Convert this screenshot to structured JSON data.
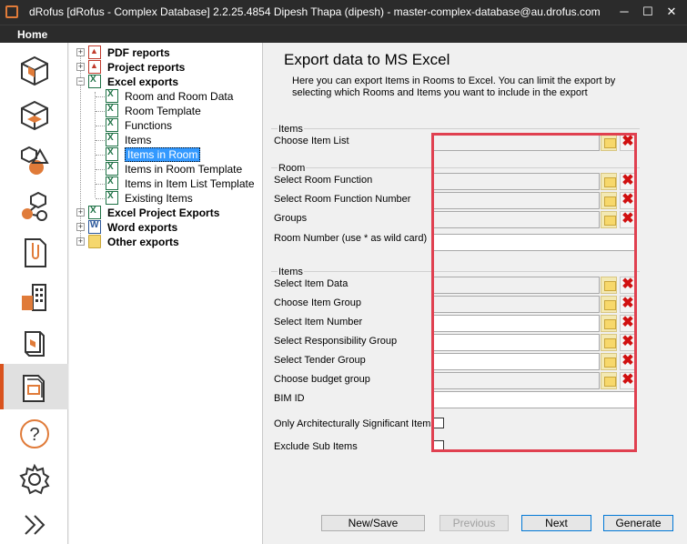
{
  "window": {
    "title": "dRofus [dRofus - Complex Database] 2.2.25.4854   Dipesh Thapa (dipesh) - master-complex-database@au.drofus.com",
    "minimize": "─",
    "maximize": "☐",
    "close": "✕"
  },
  "menubar": {
    "home": "Home"
  },
  "sidebar": {
    "icons": [
      "rooms-3d-icon",
      "room-template-icon",
      "shapes-icon",
      "items-network-icon",
      "document-clip-icon",
      "building-icon",
      "books-icon",
      "reports-icon",
      "help-icon",
      "settings-gear-icon",
      "expand-chevrons-icon"
    ],
    "active_index": 7,
    "help_glyph": "?",
    "expand_glyph": "»"
  },
  "tree": {
    "expand_glyph": "+",
    "collapse_glyph": "−",
    "nodes": [
      {
        "label": "PDF reports",
        "icon": "pdf",
        "level": 0,
        "bold": true,
        "expander": "+"
      },
      {
        "label": "Project reports",
        "icon": "pdf",
        "level": 0,
        "bold": true,
        "expander": "+"
      },
      {
        "label": "Excel exports",
        "icon": "xls",
        "level": 0,
        "bold": true,
        "expander": "−"
      },
      {
        "label": "Room and Room Data",
        "icon": "xls",
        "level": 1,
        "bold": false
      },
      {
        "label": "Room Template",
        "icon": "xls",
        "level": 1,
        "bold": false
      },
      {
        "label": "Functions",
        "icon": "xls",
        "level": 1,
        "bold": false
      },
      {
        "label": "Items",
        "icon": "xls",
        "level": 1,
        "bold": false
      },
      {
        "label": "Items in Room",
        "icon": "xls",
        "level": 1,
        "bold": false,
        "selected": true
      },
      {
        "label": "Items in Room Template",
        "icon": "xls",
        "level": 1,
        "bold": false
      },
      {
        "label": "Items in Item List Template",
        "icon": "xls",
        "level": 1,
        "bold": false
      },
      {
        "label": "Existing Items",
        "icon": "xls",
        "level": 1,
        "bold": false
      },
      {
        "label": "Excel Project Exports",
        "icon": "xls",
        "level": 0,
        "bold": true,
        "expander": "+"
      },
      {
        "label": "Word exports",
        "icon": "word",
        "level": 0,
        "bold": true,
        "expander": "+"
      },
      {
        "label": "Other exports",
        "icon": "folder",
        "level": 0,
        "bold": true,
        "expander": "+"
      }
    ]
  },
  "main": {
    "heading": "Export data to MS Excel",
    "description": "Here you can export Items in Rooms to Excel. You can limit the export by selecting which Rooms and Items you want to include in the export",
    "groups": {
      "items_top": "Items",
      "room": "Room",
      "items": "Items"
    },
    "fields": {
      "choose_item_list": "Choose Item List",
      "select_room_function": "Select Room Function",
      "select_room_function_number": "Select Room Function Number",
      "groups": "Groups",
      "room_number": "Room Number (use * as wild card)",
      "select_item_data": "Select Item Data",
      "choose_item_group": "Choose Item Group",
      "select_item_number": "Select Item Number",
      "select_responsibility_group": "Select Responsibility Group",
      "select_tender_group": "Select Tender Group",
      "choose_budget_group": "Choose budget group",
      "bim_id": "BIM ID",
      "only_arch_significant": "Only Architecturally Significant Items",
      "exclude_sub_items": "Exclude Sub Items"
    },
    "delete_glyph": "✖",
    "buttons": {
      "new_save": "New/Save",
      "previous": "Previous",
      "next": "Next",
      "generate": "Generate"
    }
  }
}
